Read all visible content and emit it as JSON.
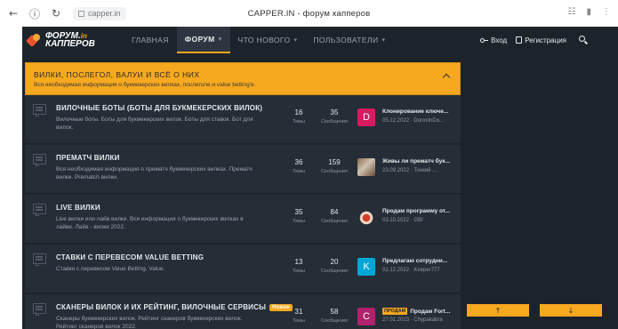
{
  "browser": {
    "back": "←",
    "info": "ⓘ",
    "reload": "↻",
    "url": "capper.in",
    "window_title": "CAPPER.IN - форум капперов",
    "right_icons": [
      "☷",
      "▮",
      "⋮"
    ]
  },
  "header": {
    "logo_line1": "ФОРУМ.",
    "logo_accent": "in",
    "logo_line2": "КАППЕРОВ",
    "tabs": [
      {
        "label": "ГЛАВНАЯ",
        "active": false,
        "caret": ""
      },
      {
        "label": "ФОРУМ",
        "active": true,
        "caret": "▾"
      },
      {
        "label": "ЧТО НОВОГО",
        "active": false,
        "caret": "▾"
      },
      {
        "label": "ПОЛЬЗОВАТЕЛИ",
        "active": false,
        "caret": "▾"
      }
    ],
    "login": "Вход",
    "register": "Регистрация"
  },
  "banner": {
    "title": "ВИЛКИ, ПОСЛЕГОЛ, ВАЛУИ И ВСЁ О НИХ",
    "subtitle": "Вся необходимая информация о букмекерских вилках, послеголе и value betting'e."
  },
  "forums": [
    {
      "title": "ВИЛОЧНЫЕ БОТЫ (БОТЫ ДЛЯ БУКМЕКЕРСКИХ ВИЛОК)",
      "badge": "",
      "desc": "Вилочные боты. Боты для букмекерских вилок. Боты для ставок. Бот для вилок.",
      "topics": "16",
      "topics_label": "Темы",
      "messages": "35",
      "messages_label": "Сообщения",
      "avatar_letter": "D",
      "avatar_color": "#d81b60",
      "last_prefix": "",
      "last_title": "Клонирование ключе...",
      "last_meta": "05.12.2022 · DoroninDo..."
    },
    {
      "title": "ПРЕМАТЧ ВИЛКИ",
      "badge": "",
      "desc": "Вся необходимая информация о прематч букмекерских вилках. Прематч вилки. Prematch вилки.",
      "topics": "36",
      "topics_label": "Темы",
      "messages": "159",
      "messages_label": "Сообщения",
      "avatar_letter": "",
      "avatar_color": "",
      "last_prefix": "",
      "last_title": "Живы ли прематч бук...",
      "last_meta": "23.09.2022 · Тонкий ..."
    },
    {
      "title": "LIVE ВИЛКИ",
      "badge": "",
      "desc": "Live вилки или лайв вилки. Вся информация о букмекерских вилках в лайве. Лайв - вилки 2022.",
      "topics": "35",
      "topics_label": "Темы",
      "messages": "84",
      "messages_label": "Сообщения",
      "avatar_letter": "",
      "avatar_color": "",
      "last_prefix": "",
      "last_title": "Продам программу от...",
      "last_meta": "03.10.2022 · GBI"
    },
    {
      "title": "СТАВКИ С ПЕРЕВЕСОМ VALUE BETTING",
      "badge": "",
      "desc": "Ставки с перевесом Value Betting. Valuе.",
      "topics": "13",
      "topics_label": "Темы",
      "messages": "20",
      "messages_label": "Сообщения",
      "avatar_letter": "K",
      "avatar_color": "#00a6d6",
      "last_prefix": "",
      "last_title": "Предлагаю сотрудни...",
      "last_meta": "01.12.2022 · Keeper777"
    },
    {
      "title": "СКАНЕРЫ ВИЛОК И ИХ РЕЙТИНГ, ВИЛОЧНЫЕ СЕРВИСЫ",
      "badge": "Новое",
      "desc": "Сканеры букмекерских вилок. Рейтинг сканеров букмекерских вилок. Рейтинг сканеров вилок 2022.",
      "topics": "31",
      "topics_label": "Темы",
      "messages": "58",
      "messages_label": "Сообщения",
      "avatar_letter": "C",
      "avatar_color": "#b0226e",
      "last_prefix": "ПРОДАМ",
      "last_title": "Продам Fort...",
      "last_meta": "27.01.2023 · Chypakabra"
    }
  ],
  "scroll": {
    "up": "↑",
    "down": "↓"
  }
}
